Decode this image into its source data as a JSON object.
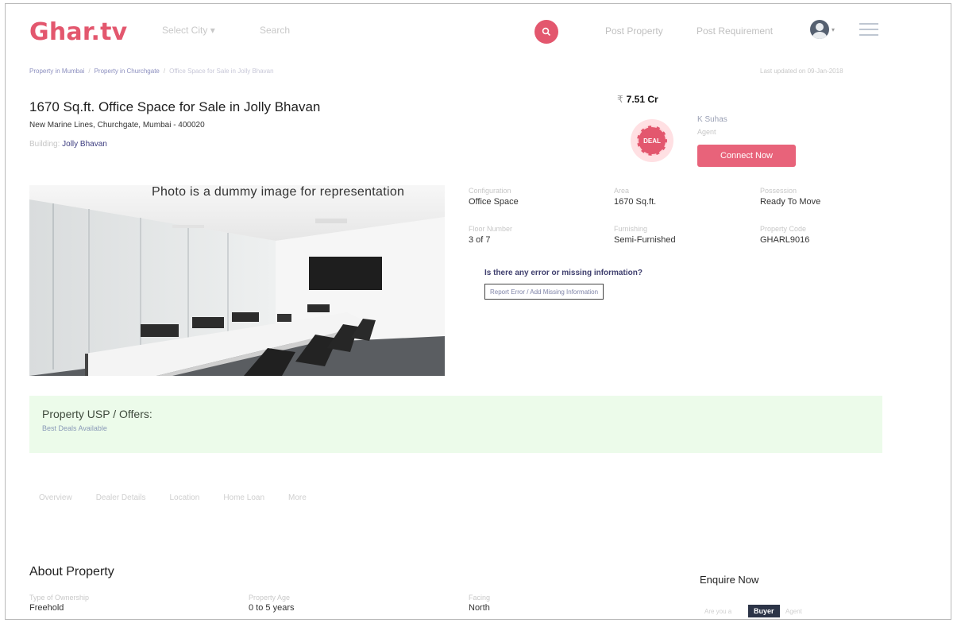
{
  "brand": {
    "logo": "Ghar.tv",
    "accent": "#e3576e"
  },
  "header": {
    "city_select": "Select City",
    "search_placeholder": "Search",
    "post_property": "Post Property",
    "post_requirement": "Post Requirement"
  },
  "breadcrumb": {
    "items": [
      "Property in Mumbai",
      "Property in Churchgate"
    ],
    "current": "Office Space for Sale in Jolly Bhavan",
    "updated": "Last updated on 09-Jan-2018"
  },
  "listing": {
    "title": "1670 Sq.ft. Office Space for Sale in Jolly Bhavan",
    "address": "New Marine Lines, Churchgate, Mumbai - 400020",
    "building_label": "Building:",
    "building_value": "Jolly Bhavan",
    "price_symbol": "₹",
    "price": "7.51 Cr",
    "image_caption": "Photo is a dummy image for representation"
  },
  "agent": {
    "badge": "DEAL",
    "name": "K Suhas",
    "role": "Agent",
    "connect": "Connect Now"
  },
  "specs": [
    {
      "label": "Configuration",
      "value": "Office Space"
    },
    {
      "label": "Area",
      "value": "1670 Sq.ft."
    },
    {
      "label": "Possession",
      "value": "Ready To Move"
    },
    {
      "label": "Floor Number",
      "value": "3 of 7"
    },
    {
      "label": "Furnishing",
      "value": "Semi-Furnished"
    },
    {
      "label": "Property Code",
      "value": "GHARL9016"
    }
  ],
  "error_box": {
    "question": "Is there any error or missing information?",
    "button": "Report Error / Add Missing Information"
  },
  "usp": {
    "title": "Property USP / Offers:",
    "text": "Best Deals Available"
  },
  "tabs": [
    "Overview",
    "Dealer Details",
    "Location",
    "Home Loan",
    "More"
  ],
  "about": {
    "title": "About Property",
    "items": [
      {
        "label": "Type of Ownership",
        "value": "Freehold"
      },
      {
        "label": "Property Age",
        "value": "0 to 5 years"
      },
      {
        "label": "Facing",
        "value": "North"
      }
    ]
  },
  "enquire": {
    "title": "Enquire Now",
    "you_are": "Are you a",
    "buyer": "Buyer",
    "agent": "Agent"
  }
}
